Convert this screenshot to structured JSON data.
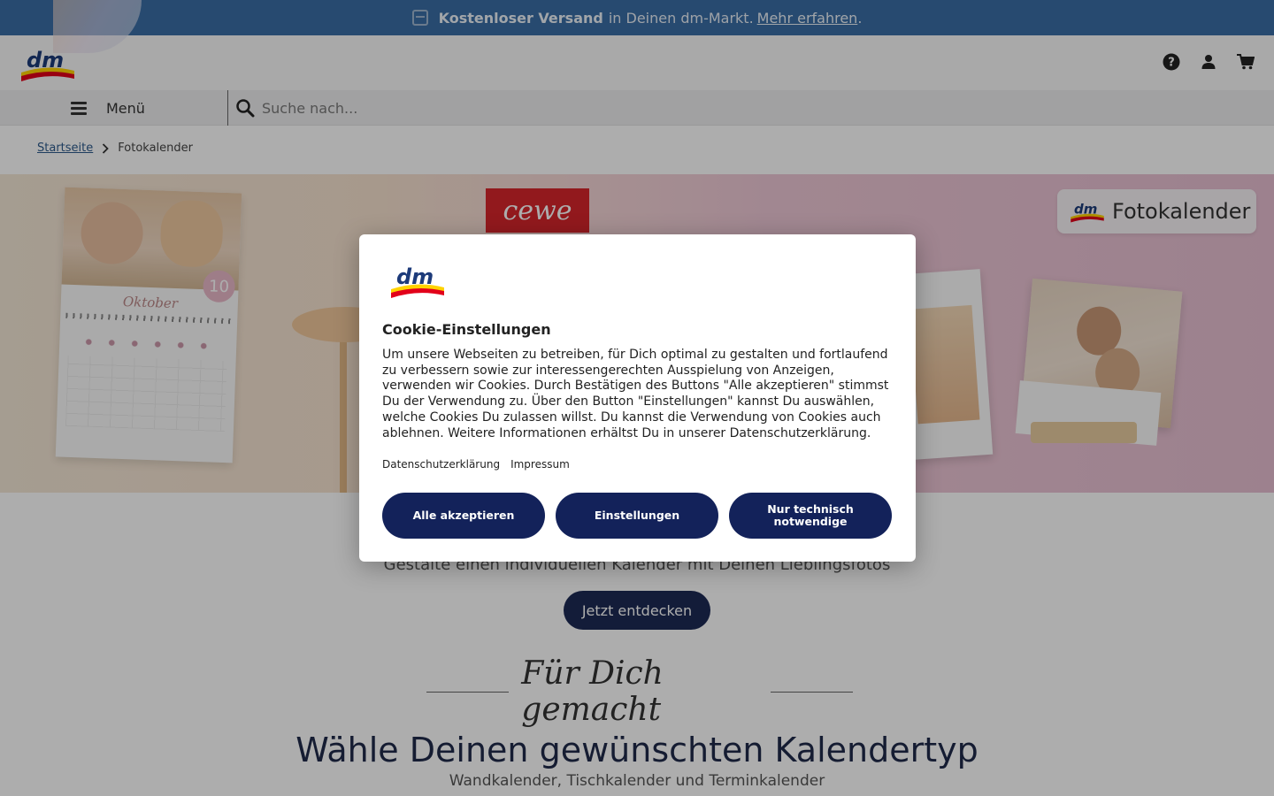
{
  "promo": {
    "bold": "Kostenloser Versand",
    "text": "in Deinen dm-Markt.",
    "link": "Mehr erfahren",
    "suffix": "."
  },
  "header": {
    "logo_text": "dm",
    "icons": [
      "help-icon",
      "account-icon",
      "cart-icon"
    ]
  },
  "nav": {
    "menu_label": "Menü",
    "search_placeholder": "Suche nach..."
  },
  "breadcrumb": {
    "home": "Startseite",
    "current": "Fotokalender"
  },
  "hero": {
    "calendar_month": "Oktober",
    "calendar_number": "10",
    "cewe_logo": "cewe",
    "badge_logo": "dm",
    "badge_text": "Fotokalender"
  },
  "content": {
    "subline": "Gestalte einen individuellen Kalender mit Deinen Lieblingsfotos",
    "cta": "Jetzt entdecken",
    "script": "Für Dich gemacht",
    "title": "Wähle Deinen gewünschten Kalendertyp",
    "subtitle": "Wandkalender, Tischkalender und Terminkalender"
  },
  "cookie_modal": {
    "logo_text": "dm",
    "title": "Cookie-Einstellungen",
    "body": "Um unsere Webseiten zu betreiben, für Dich optimal zu gestalten und fortlaufend zu verbessern sowie zur interessengerechten Ausspielung von Anzeigen, verwenden wir Cookies. Durch Bestätigen des Buttons \"Alle akzeptieren\" stimmst Du der Verwendung zu. Über den Button \"Einstellungen\" kannst Du auswählen, welche Cookies Du zulassen willst. Du kannst die Verwendung von Cookies auch ablehnen. Weitere Informationen erhältst Du in unserer Datenschutzerklärung.",
    "link_privacy": "Datenschutzerklärung",
    "link_imprint": "Impressum",
    "btn_accept": "Alle akzeptieren",
    "btn_settings": "Einstellungen",
    "btn_necessary": "Nur technisch notwendige"
  },
  "colors": {
    "promo_bg": "#3a6ea5",
    "button_navy": "#13225a",
    "dm_red": "#e2001a",
    "dm_yellow": "#ffd300"
  }
}
